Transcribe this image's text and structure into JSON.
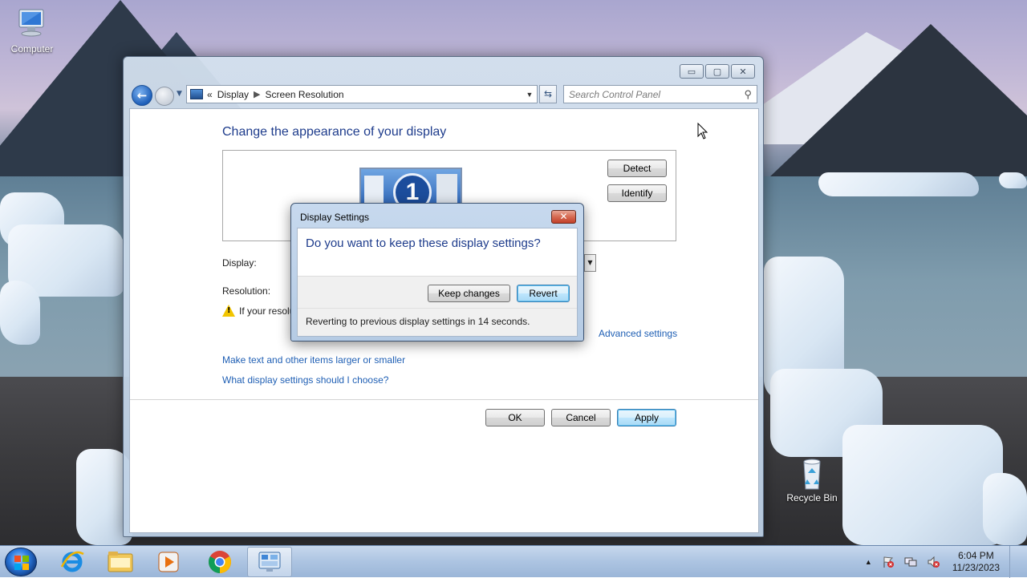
{
  "desktop": {
    "icons": [
      {
        "name": "computer",
        "label": "Computer"
      },
      {
        "name": "recycle-bin",
        "label": "Recycle Bin"
      }
    ]
  },
  "window": {
    "controls": {
      "minimize": "▭",
      "maximize": "▢",
      "close": "✕"
    },
    "nav": {
      "back_icon": "back-arrow-icon",
      "forward_icon": "forward-arrow-icon",
      "breadcrumb_prefix": "«",
      "breadcrumb": [
        "Display",
        "Screen Resolution"
      ],
      "search_placeholder": "Search Control Panel"
    },
    "page_title": "Change the appearance of your display",
    "monitor_number": "1",
    "buttons": {
      "detect": "Detect",
      "identify": "Identify",
      "ok": "OK",
      "cancel": "Cancel",
      "apply": "Apply"
    },
    "labels": {
      "display": "Display:",
      "resolution": "Resolution:",
      "warning_text": "If your resolu"
    },
    "links": {
      "advanced": "Advanced settings",
      "text_size": "Make text and other items larger or smaller",
      "which_settings": "What display settings should I choose?"
    }
  },
  "dialog": {
    "title": "Display Settings",
    "close": "✕",
    "question": "Do you want to keep these display settings?",
    "keep_label": "Keep changes",
    "revert_label": "Revert",
    "status": "Reverting to previous display settings in 14 seconds."
  },
  "taskbar": {
    "items": [
      "start-button",
      "internet-explorer",
      "file-explorer",
      "media-player",
      "chrome",
      "control-panel"
    ],
    "tray": {
      "time": "6:04 PM",
      "date": "11/23/2023"
    }
  },
  "colors": {
    "link": "#1f5fb4",
    "title_blue": "#1e3c8c",
    "apply_border": "#3c7fb1"
  }
}
